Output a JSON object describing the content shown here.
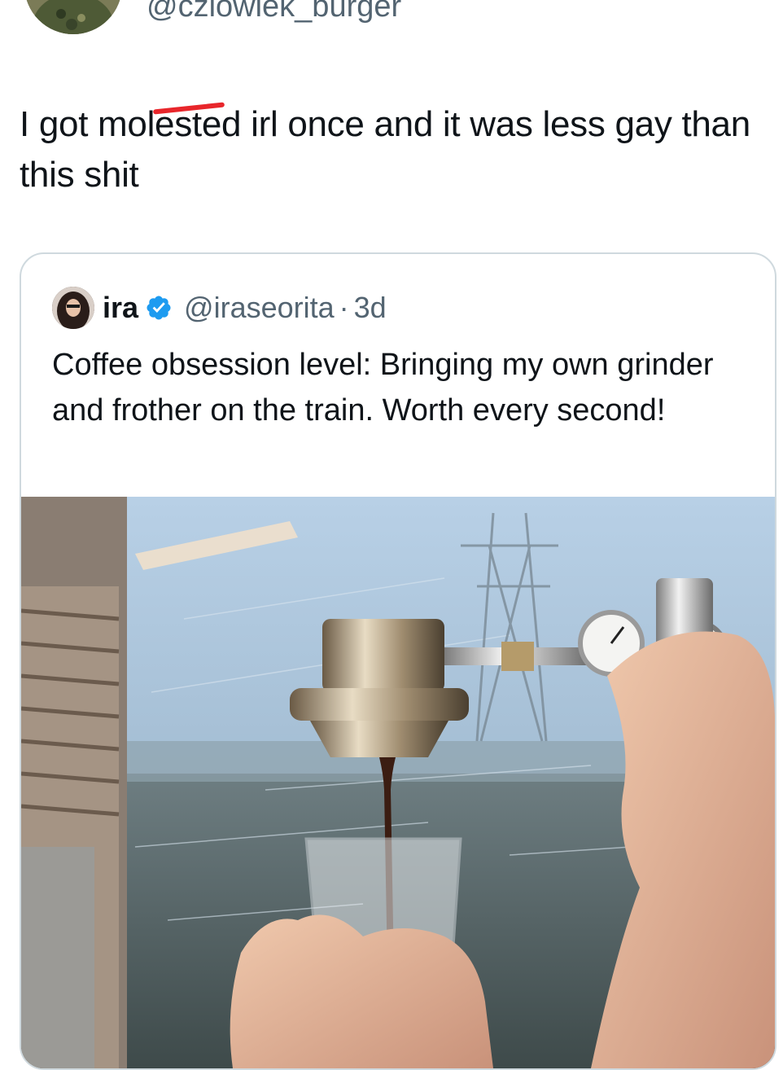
{
  "tweet": {
    "handle": "@czlowiek_burger",
    "text_part1": "I got mol",
    "text_strike": "este",
    "text_part2": "d irl once and it was less gay than this shit"
  },
  "quoted_tweet": {
    "name": "ira",
    "verified": true,
    "handle": "@iraseorita",
    "separator": "·",
    "time": "3d",
    "text": "Coffee obsession level: Bringing my own grinder and frother on the train. Worth every second!"
  },
  "icons": {
    "verified": "verified-badge-icon"
  },
  "colors": {
    "text": "#0f1419",
    "secondary": "#536471",
    "border": "#cfd9de",
    "verified": "#1d9bf0",
    "strike": "#e8262b"
  }
}
